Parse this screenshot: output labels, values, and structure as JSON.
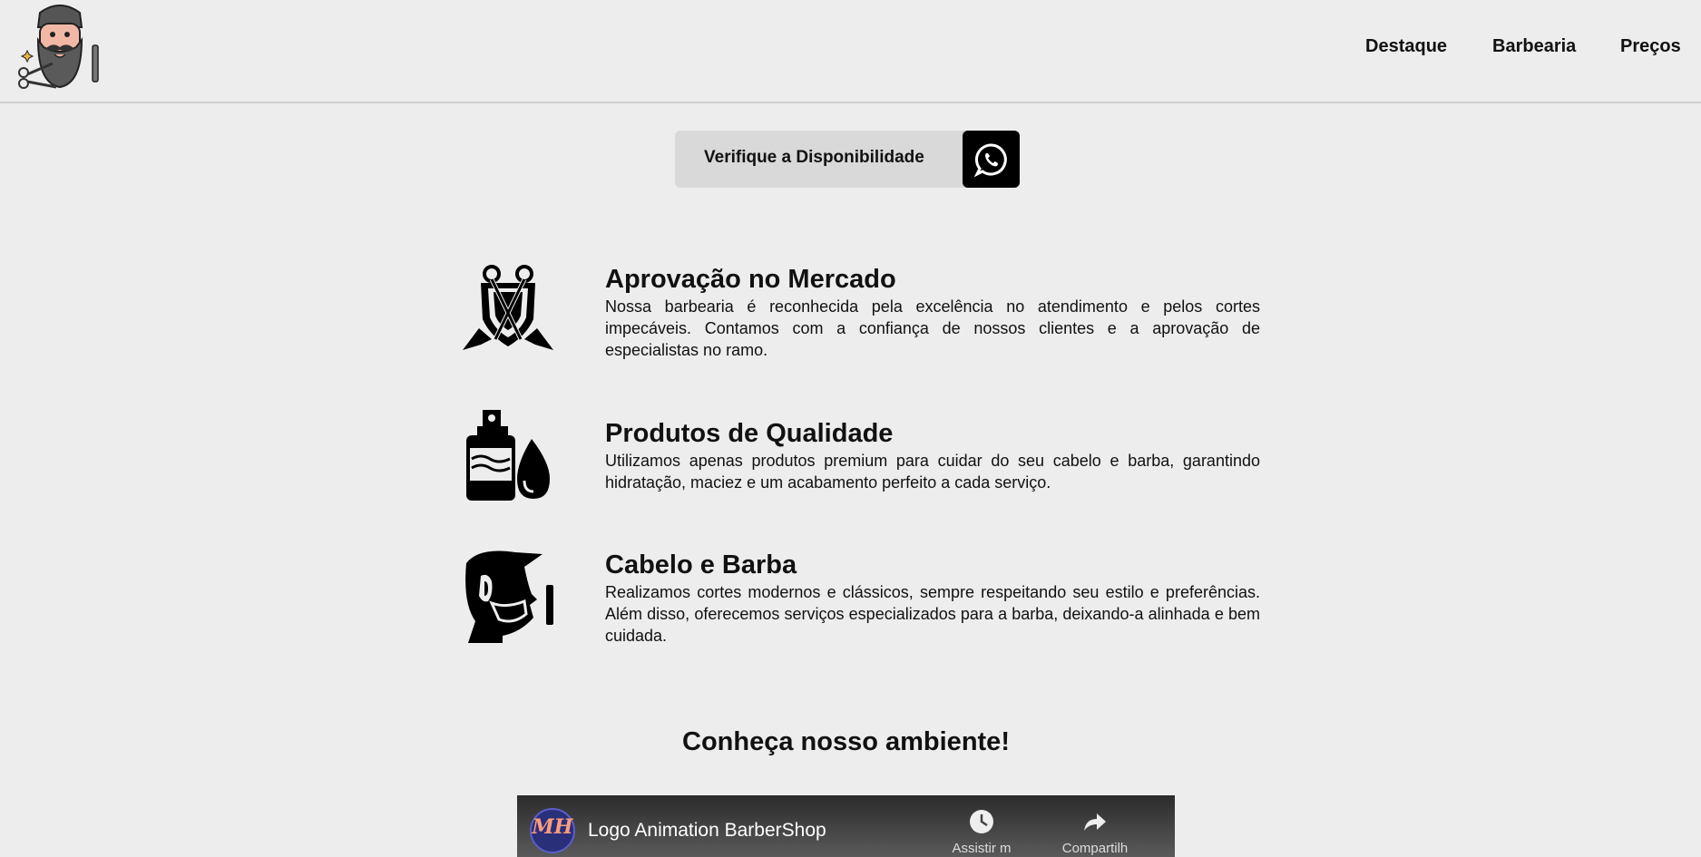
{
  "header": {
    "logo_name": "barber-logo",
    "nav": [
      "Destaque",
      "Barbearia",
      "Preços"
    ]
  },
  "cta": {
    "label": "Verifique a Disponibilidade",
    "icon": "whatsapp-icon"
  },
  "features": [
    {
      "icon": "scissors-shield-icon",
      "title": "Aprovação no Mercado",
      "description": "Nossa barbearia é reconhecida pela excelência no atendimento e pelos cortes impecáveis. Contamos com a confiança de nossos clientes e a aprovação de especialistas no ramo."
    },
    {
      "icon": "product-bottle-icon",
      "title": "Produtos de Qualidade",
      "description": "Utilizamos apenas produtos premium para cuidar do seu cabelo e barba, garantindo hidratação, maciez e um acabamento perfeito a cada serviço."
    },
    {
      "icon": "hair-beard-icon",
      "title": "Cabelo e Barba",
      "description": "Realizamos cortes modernos e clássicos, sempre respeitando seu estilo e preferências. Além disso, oferecemos serviços especializados para a barba, deixando-a alinhada e bem cuidada."
    }
  ],
  "section": {
    "title": "Conheça nosso ambiente!"
  },
  "video": {
    "channel_avatar_text": "MH",
    "title": "Logo Animation BarberShop",
    "watch_later": "Assistir m",
    "share": "Compartilh"
  }
}
